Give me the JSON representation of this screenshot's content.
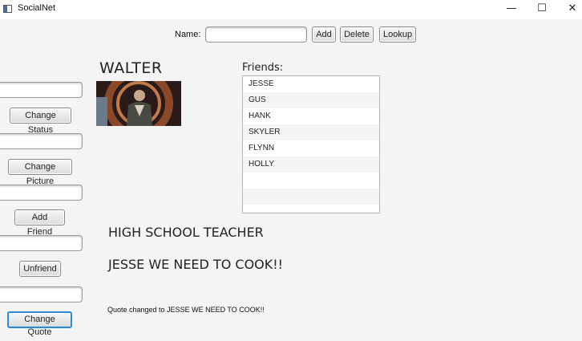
{
  "window": {
    "title": "SocialNet",
    "controls": {
      "minimize": "—",
      "maximize": "☐",
      "close": "✕"
    }
  },
  "top_bar": {
    "name_label": "Name:",
    "name_value": "",
    "add_label": "Add",
    "delete_label": "Delete",
    "lookup_label": "Lookup"
  },
  "sidebar": {
    "status_input": "",
    "change_status_label": "Change Status",
    "picture_input": "",
    "change_picture_label": "Change Picture",
    "friend_input": "",
    "add_friend_label": "Add Friend",
    "unfriend_input": "",
    "unfriend_label": "Unfriend",
    "quote_input": "",
    "change_quote_label": "Change Quote"
  },
  "profile": {
    "name": "WALTER",
    "friends_label": "Friends:",
    "friends": [
      "JESSE",
      "GUS",
      "HANK",
      "SKYLER",
      "FLYNN",
      "HOLLY",
      "",
      "",
      ""
    ],
    "status": "HIGH SCHOOL TEACHER",
    "quote": "JESSE WE NEED TO COOK!!"
  },
  "message": "Quote changed to JESSE WE NEED TO COOK!!"
}
